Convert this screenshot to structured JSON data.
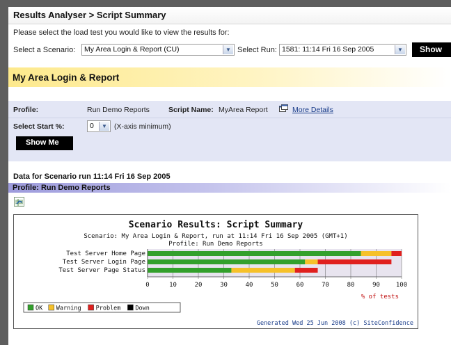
{
  "header": {
    "breadcrumb": "Results Analyser > Script Summary"
  },
  "form": {
    "instruction": "Please select the load test you would like to view the results for:",
    "scenario_label": "Select a Scenario:",
    "scenario_value": "My Area Login & Report (CU)",
    "run_label": "Select Run:",
    "run_value": "1581: 11:14 Fri 16 Sep 2005",
    "show_button": "Show"
  },
  "section": {
    "title": "My Area Login & Report"
  },
  "profile": {
    "profile_label": "Profile:",
    "profile_value": "Run Demo Reports",
    "script_name_label": "Script Name:",
    "script_name_value": "MyArea Report",
    "more_details": "More Details",
    "start_label": "Select Start %:",
    "start_value": "0",
    "start_hint": "(X-axis minimum)",
    "show_me_button": "Show Me"
  },
  "results": {
    "data_for": "Data for Scenario run 11:14 Fri 16 Sep 2005",
    "profile_strip": "Profile: Run Demo Reports"
  },
  "chart_data": {
    "type": "bar",
    "orientation": "horizontal",
    "stacked": true,
    "title": "Scenario Results: Script Summary",
    "subtitle": "Scenario: My Area Login & Report, run at 11:14 Fri 16 Sep 2005 (GMT+1)",
    "subtitle2": "Profile: Run Demo Reports",
    "categories": [
      "Test Server Home Page",
      "Test Server Login Page",
      "Test Server Page Status"
    ],
    "series": [
      {
        "name": "OK",
        "color": "#33a02c",
        "values": [
          84,
          62,
          33
        ]
      },
      {
        "name": "Warning",
        "color": "#f6c12a",
        "values": [
          12,
          5,
          25
        ]
      },
      {
        "name": "Problem",
        "color": "#e0201e",
        "values": [
          4,
          29,
          9
        ]
      },
      {
        "name": "Down",
        "color": "#000000",
        "values": [
          0,
          0,
          0
        ]
      }
    ],
    "xlim": [
      0,
      100
    ],
    "xticks": [
      "0",
      "10",
      "20",
      "30",
      "40",
      "50",
      "60",
      "70",
      "80",
      "90",
      "100"
    ],
    "xlabel": "% of tests",
    "footer": "Generated Wed 25 Jun 2008 (c) SiteConfidence"
  }
}
